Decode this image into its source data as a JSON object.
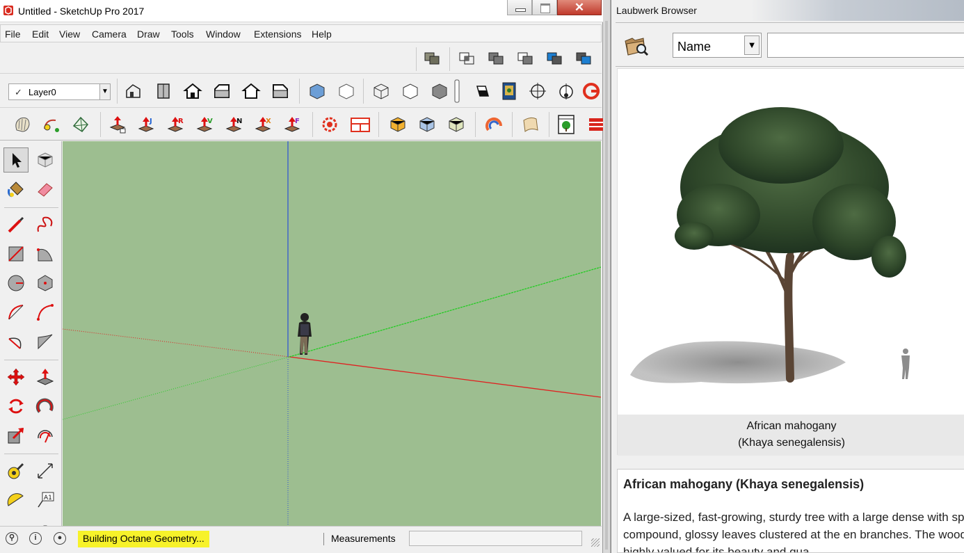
{
  "sketchup": {
    "title": "Untitled - SketchUp Pro 2017",
    "close_glyph": "✕",
    "menu": [
      "File",
      "Edit",
      "View",
      "Camera",
      "Draw",
      "Tools",
      "Window",
      "Extensions",
      "Help"
    ],
    "layer": {
      "check": "✓",
      "name": "Layer0",
      "arrow": "▼"
    },
    "status": {
      "message": "Building Octane Geometry...",
      "measurements_label": "Measurements",
      "measurements_value": "",
      "icons": [
        "geo-location-icon",
        "credits-icon",
        "user-icon"
      ]
    },
    "viewport": {
      "background": "#9dbe90"
    }
  },
  "laubwerk": {
    "title": "Laubwerk Browser",
    "sort_by": "Name",
    "select_arrow": "▼",
    "search_value": "",
    "plant": {
      "common_name": "African mahogany",
      "latin_name": "(Khaya senegalensis)",
      "heading": "African mahogany (Khaya senegalensis)",
      "description": "A large-sized, fast-growing, sturdy tree with a large dense with spiraling compound, glossy leaves clustered at the en branches. The wood is highly valued for its beauty and qua"
    }
  },
  "colors": {
    "status_highlight": "#f7f22a",
    "axis_red": "#e02020",
    "axis_green": "#22cc22",
    "axis_blue": "#2b4fd6",
    "close_button": "#c0392b"
  }
}
